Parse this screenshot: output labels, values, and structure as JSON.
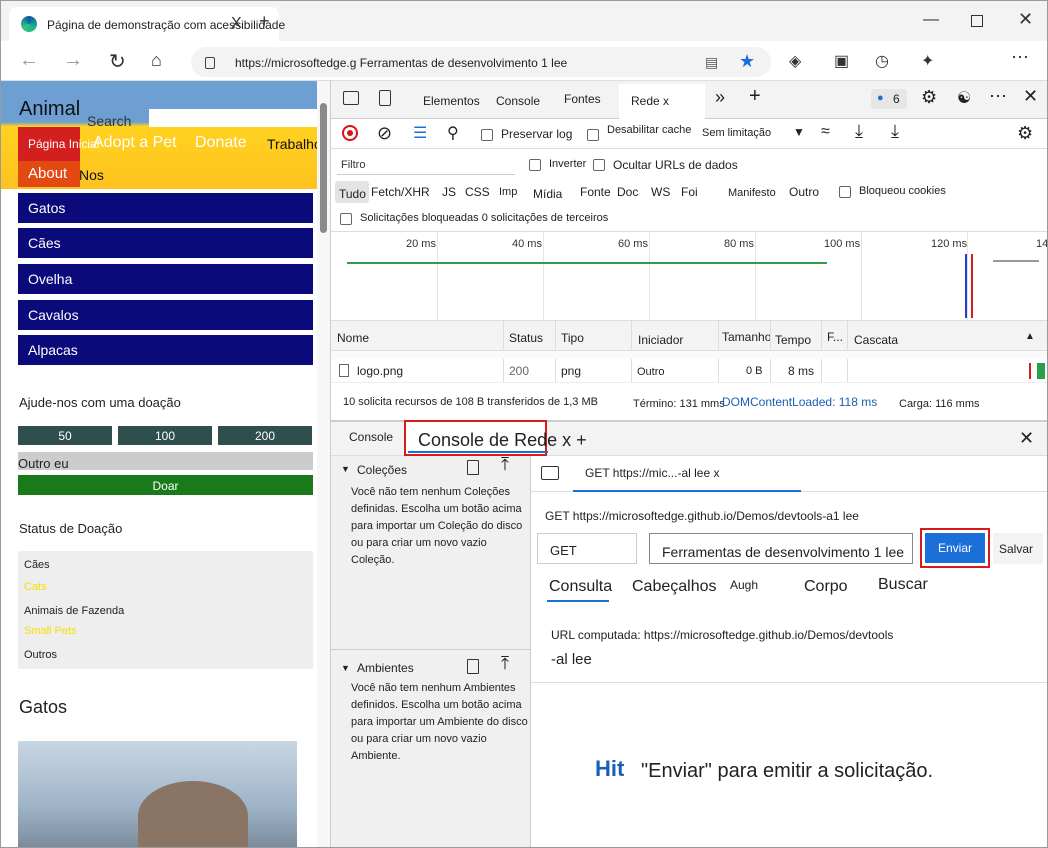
{
  "browser": {
    "tab_title": "Página de demonstração com acessibilidade",
    "tab_close": "X",
    "new_tab": "+",
    "url": "https://microsoftedge.g Ferramentas de desenvolvimento 1 lee"
  },
  "page": {
    "brand": "Animal",
    "search_label": "Search",
    "nav": {
      "home": "Página Inicial",
      "adopt": "Adopt a Pet",
      "donate": "Donate",
      "jobs": "Trabalhos",
      "about": "About",
      "us": "Nos"
    },
    "animals": [
      "Gatos",
      "Cães",
      "Ovelha",
      "Cavalos",
      "Alpacas"
    ],
    "donate_heading": "Ajude-nos com uma doação",
    "amounts": [
      "50",
      "100",
      "200"
    ],
    "other": "Outro eu",
    "donate_button": "Doar",
    "status_heading": "Status de Doação",
    "status_items": [
      {
        "label": "Cães",
        "color": "#222222"
      },
      {
        "label": "Cats",
        "color": "#f5e000"
      },
      {
        "label": "Animais de Fazenda",
        "color": "#222222"
      },
      {
        "label": "Small Pets",
        "color": "#f5e000"
      },
      {
        "label": "Outros",
        "color": "#222222"
      }
    ],
    "cats_heading": "Gatos"
  },
  "devtools": {
    "tabs": {
      "elements": "Elementos",
      "console": "Console",
      "sources": "Fontes",
      "network": "Rede x"
    },
    "issues_count": "6",
    "toolbar": {
      "preserve_log": "Preservar log",
      "disable_cache": "Desabilitar cache",
      "throttling": "Sem limitação"
    },
    "filter_placeholder": "Filtro",
    "invert": "Inverter",
    "hide_data_urls": "Ocultar URLs de dados",
    "types": [
      "Tudo",
      "Fetch/XHR",
      "JS",
      "CSS",
      "Imp",
      "Mídia",
      "Fonte",
      "Doc",
      "WS",
      "Foi",
      "Manifesto",
      "Outro"
    ],
    "blocked_cookies": "Bloqueou cookies",
    "blocked_requests": "Solicitações bloqueadas 0 solicitações de terceiros",
    "timeline_ticks": [
      "20 ms",
      "40 ms",
      "60 ms",
      "80 ms",
      "100 ms",
      "120 ms",
      "14"
    ],
    "columns": [
      "Nome",
      "Status",
      "Tipo",
      "Iniciador",
      "Tamanho",
      "Tempo",
      "F...",
      "Cascata"
    ],
    "row": {
      "name": "logo.png",
      "status": "200",
      "type": "png",
      "initiator": "Outro",
      "size": "0 B",
      "time": "8 ms"
    },
    "summary": {
      "requests": "10 solicita recursos de 108 B transferidos de 1,3 MB",
      "finish": "Término: 131 mms",
      "dcl": "DOMContentLoaded: 118 ms",
      "load": "Carga: 116 mms"
    },
    "drawer": {
      "console_tab": "Console",
      "network_console_tab": "Console de Rede x +",
      "collections": "Coleções",
      "collections_text": "Você não tem nenhum Coleções definidas. Escolha um botão acima para importar um Coleção do disco ou para criar um novo vazio Coleção.",
      "environments": "Ambientes",
      "environments_text": "Você não tem nenhum Ambientes definidos. Escolha um botão acima para importar um Ambiente do disco ou para criar um novo vazio Ambiente.",
      "request_tab": "GET https://mic...-al lee x",
      "request_line": "GET https://microsoftedge.github.io/Demos/devtools-a1 lee",
      "method": "GET",
      "url_value": "Ferramentas de desenvolvimento 1 lee",
      "send": "Enviar",
      "save": "Salvar",
      "subtabs": [
        "Consulta",
        "Cabeçalhos",
        "Augh",
        "Corpo",
        "Buscar"
      ],
      "computed_url": "URL computada: https://microsoftedge.github.io/Demos/devtools",
      "computed_url_2": "-al lee",
      "hint_bold": "Hit",
      "hint": "\"Enviar\" para emitir a solicitação."
    }
  }
}
